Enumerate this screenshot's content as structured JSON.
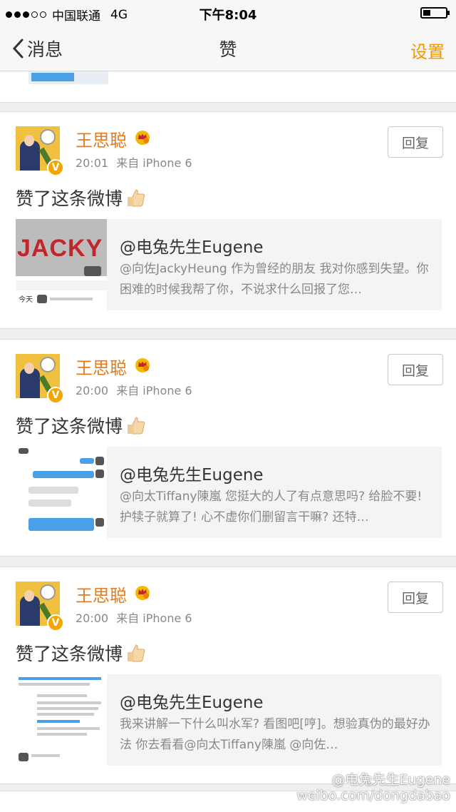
{
  "status_bar": {
    "carrier": "中国联通",
    "network": "4G",
    "time": "下午8:04"
  },
  "nav": {
    "back_label": "消息",
    "title": "赞",
    "settings_label": "设置"
  },
  "cards": [
    {
      "user": "王思聪",
      "time": "20:01",
      "source": "来自 iPhone 6",
      "reply_label": "回复",
      "action_text": "赞了这条微博",
      "quoted_author": "@电兔先生Eugene",
      "quoted_text": "@向佐JackyHeung 作为曾经的朋友 我对你感到失望。你困难的时候我帮了你，不说求什么回报了您…",
      "thumb_today_label": "今天",
      "thumb_word": "JACKY"
    },
    {
      "user": "王思聪",
      "time": "20:00",
      "source": "来自 iPhone 6",
      "reply_label": "回复",
      "action_text": "赞了这条微博",
      "quoted_author": "@电兔先生Eugene",
      "quoted_text": "@向太Tiffany陳嵐 您挺大的人了有点意思吗? 给脸不要! 护犊子就算了! 心不虚你们删留言干嘛? 还特…"
    },
    {
      "user": "王思聪",
      "time": "20:00",
      "source": "来自 iPhone 6",
      "reply_label": "回复",
      "action_text": "赞了这条微博",
      "quoted_author": "@电兔先生Eugene",
      "quoted_text": "我来讲解一下什么叫水军? 看图吧[哼]。想验真伪的最好办法 你去看看@向太Tiffany陳嵐 @向佐…"
    }
  ],
  "watermark": {
    "handle": "@电兔先生Eugene",
    "url": "weibo.com/dongdabao"
  },
  "icons": {
    "back": "chevron-left-icon",
    "crown": "crown-icon",
    "verified": "verified-icon",
    "thumbs_up": "thumbs-up-icon"
  },
  "colors": {
    "accent": "#f09800",
    "username": "#e97a1a",
    "verified": "#f5a500"
  }
}
